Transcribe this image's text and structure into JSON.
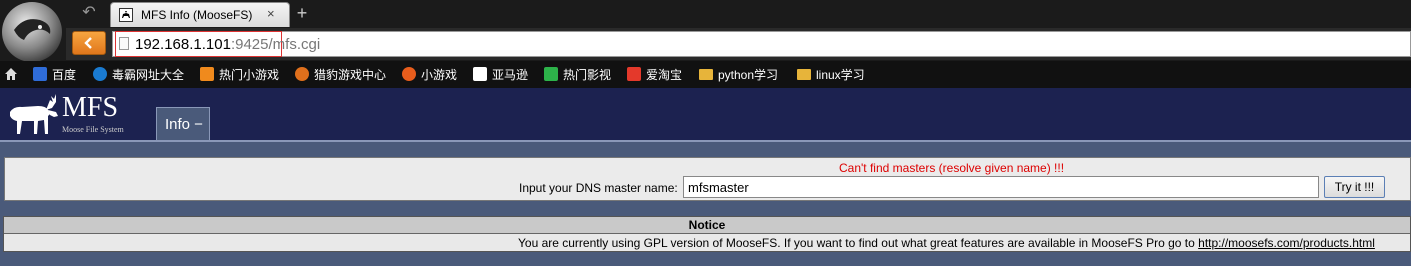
{
  "browser": {
    "tab_title": "MFS Info (MooseFS)",
    "tab_close": "×",
    "new_tab": "+",
    "url_host": "192.168.1.101",
    "url_port": ":9425/",
    "url_path": "mfs.cgi",
    "bookmarks": [
      {
        "label": "百度",
        "icon": "baidu-icon",
        "color": "#2f6cd8"
      },
      {
        "label": "毒霸网址大全",
        "icon": "duba-icon",
        "color": "#1a7bd1"
      },
      {
        "label": "热门小游戏",
        "icon": "games-icon",
        "color": "#f08a1d"
      },
      {
        "label": "猎豹游戏中心",
        "icon": "cheetah-icon",
        "color": "#e0701c"
      },
      {
        "label": "小游戏",
        "icon": "mini-games-icon",
        "color": "#e85d1c"
      },
      {
        "label": "亚马逊",
        "icon": "amazon-icon",
        "color": "#ffffff"
      },
      {
        "label": "热门影视",
        "icon": "video-icon",
        "color": "#2db34a"
      },
      {
        "label": "爱淘宝",
        "icon": "taobao-icon",
        "color": "#e4392b"
      },
      {
        "label": "python学习",
        "icon": "folder-icon",
        "color": "#e7b43a"
      },
      {
        "label": "linux学习",
        "icon": "folder-icon",
        "color": "#e7b43a"
      }
    ]
  },
  "page": {
    "logo_text": "MFS",
    "logo_sub": "Moose File System",
    "info_tab": "Info −",
    "error_msg": "Can't find masters (resolve given name) !!!",
    "dns_label": "Input your DNS master name:",
    "dns_value": "mfsmaster",
    "try_button": "Try it !!!",
    "notice_title": "Notice",
    "notice_text": "You are currently using GPL version of MooseFS. If you want to find out what great features are available in MooseFS Pro go to",
    "notice_link": "http://moosefs.com/products.html"
  },
  "colors": {
    "header_bg": "#1c2250",
    "page_bg": "#4a5a7a",
    "error": "#dd0000",
    "back_button": "#e0771c"
  }
}
